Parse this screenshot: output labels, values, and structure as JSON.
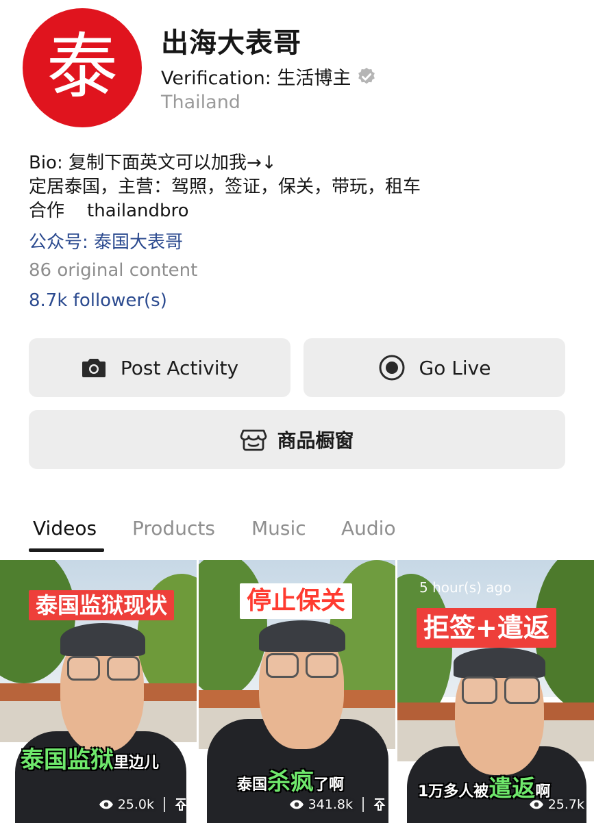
{
  "profile": {
    "avatar_char": "泰",
    "name": "出海大表哥",
    "verification": "Verification: 生活博主",
    "country": "Thailand"
  },
  "bio": {
    "line1": "Bio: 复制下面英文可以加我→↓",
    "line2": "定居泰国，主营：驾照，签证，保关，带玩，租车",
    "line3": "合作    thailandbro",
    "official_account": "公众号: 泰国大表哥",
    "content_count": "86 original content",
    "followers": "8.7k follower(s)"
  },
  "actions": {
    "post_activity": "Post Activity",
    "go_live": "Go Live",
    "shop_window": "商品橱窗"
  },
  "tabs": [
    "Videos",
    "Products",
    "Music",
    "Audio"
  ],
  "videos": [
    {
      "top_label": "泰国监狱现状",
      "sub_highlight": "泰国监狱",
      "sub_suffix": "里边儿",
      "views": "25.0k"
    },
    {
      "top_label": "停止保关",
      "sub_prefix": "泰国",
      "sub_highlight": "杀疯",
      "sub_suffix": "了啊",
      "views": "341.8k"
    },
    {
      "time": "5 hour(s) ago",
      "top_label": "拒签+遣返",
      "sub_prefix": "1万多人被",
      "sub_highlight": "遣返",
      "sub_suffix": "啊",
      "views": "25.7k"
    }
  ],
  "colors": {
    "avatar_bg": "#e0141e",
    "link_blue": "#2b4a8f",
    "button_bg": "#ededed",
    "label_red": "#ee3f3a",
    "subtitle_green": "#6fe86c"
  }
}
